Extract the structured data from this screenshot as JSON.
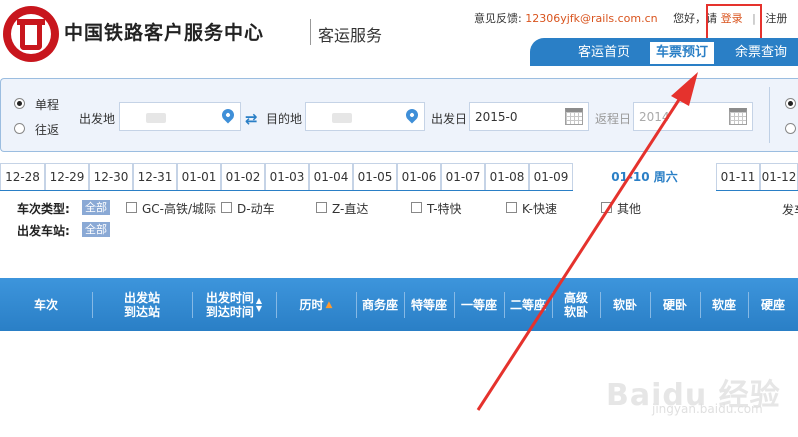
{
  "header": {
    "site_title": "中国铁路客户服务中心",
    "site_subtitle": "客运服务",
    "feedback_label": "意见反馈:",
    "feedback_email": "12306yjfk@rails.com.cn",
    "greeting": "您好，请",
    "login": "登录",
    "separator": "|",
    "register": "注册",
    "nav": [
      "客运首页",
      "车票预订",
      "余票查询"
    ],
    "active_nav": "车票预订"
  },
  "search": {
    "trip_types": [
      {
        "label": "单程",
        "checked": true
      },
      {
        "label": "往返",
        "checked": false
      }
    ],
    "from_label": "出发地",
    "to_label": "目的地",
    "depart_date_label": "出发日",
    "depart_date_value": "2015-0",
    "return_date_label": "返程日",
    "return_date_value": "2014"
  },
  "date_tabs": [
    {
      "label": "12-28",
      "active": false
    },
    {
      "label": "12-29",
      "active": false
    },
    {
      "label": "12-30",
      "active": false
    },
    {
      "label": "12-31",
      "active": false
    },
    {
      "label": "01-01",
      "active": false
    },
    {
      "label": "01-02",
      "active": false
    },
    {
      "label": "01-03",
      "active": false
    },
    {
      "label": "01-04",
      "active": false
    },
    {
      "label": "01-05",
      "active": false
    },
    {
      "label": "01-06",
      "active": false
    },
    {
      "label": "01-07",
      "active": false
    },
    {
      "label": "01-08",
      "active": false
    },
    {
      "label": "01-09",
      "active": false
    },
    {
      "label": "01-10 周六",
      "active": true
    },
    {
      "label": "01-11",
      "active": false
    },
    {
      "label": "01-12",
      "active": false
    }
  ],
  "filters": {
    "train_type_label": "车次类型:",
    "all_label": "全部",
    "train_types": [
      "GC-高铁/城际",
      "D-动车",
      "Z-直达",
      "T-特快",
      "K-快速",
      "其他"
    ],
    "station_label": "出发车站:",
    "cut_off_label": "发车"
  },
  "results_header": {
    "columns": [
      "车次",
      "出发站\n到达站",
      "出发时间\n到达时间",
      "历时",
      "商务座",
      "特等座",
      "一等座",
      "二等座",
      "高级\n软卧",
      "软卧",
      "硬卧",
      "软座",
      "硬座"
    ]
  },
  "watermark": {
    "brand": "Baidu 经验",
    "url": "jingyan.baidu.com"
  },
  "colors": {
    "brand_blue": "#2a7fc6",
    "accent_orange": "#d9541e",
    "annotation_red": "#e5322d",
    "logo_red": "#c8161d"
  }
}
